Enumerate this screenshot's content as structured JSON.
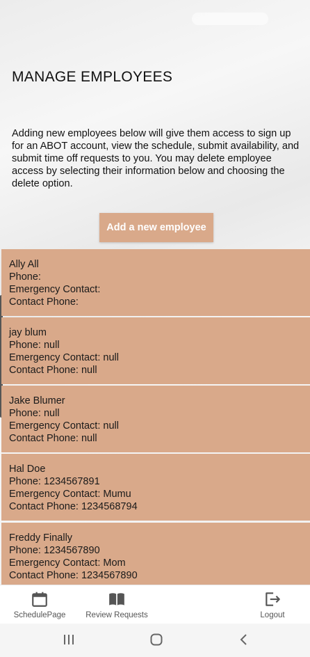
{
  "page": {
    "title": "MANAGE EMPLOYEES",
    "description": "Adding new employees below will give them access to sign up for an ABOT account, view the schedule, submit availability, and submit time off requests to you. You may delete employee access by selecting their information below and choosing the delete option.",
    "add_button_label": "Add a new employee"
  },
  "employees": [
    {
      "name": "Ally All",
      "phone": "Phone:",
      "emergency": "Emergency Contact:",
      "contact_phone": "Contact Phone:"
    },
    {
      "name": "jay blum",
      "phone": "Phone: null",
      "emergency": "Emergency Contact: null",
      "contact_phone": "Contact Phone: null"
    },
    {
      "name": "Jake Blumer",
      "phone": "Phone: null",
      "emergency": "Emergency Contact: null",
      "contact_phone": "Contact Phone: null"
    },
    {
      "name": "Hal Doe",
      "phone": "Phone: 1234567891",
      "emergency": "Emergency Contact: Mumu",
      "contact_phone": "Contact Phone: 1234568794"
    },
    {
      "name": "Freddy Finally",
      "phone": "Phone: 1234567890",
      "emergency": "Emergency Contact: Mom",
      "contact_phone": "Contact Phone: 1234567890"
    }
  ],
  "bottom_nav": {
    "schedule": {
      "label": "SchedulePage",
      "icon": "calendar-icon"
    },
    "requests": {
      "label": "Review Requests",
      "icon": "book-icon"
    },
    "logout": {
      "label": "Logout",
      "icon": "logout-icon"
    }
  },
  "system_nav": {
    "recents": "recents-icon",
    "home": "home-icon",
    "back": "back-icon"
  },
  "colors": {
    "card_background": "#d9a98a",
    "button_background": "#d9a98a",
    "button_text": "#ffffff",
    "nav_icon": "#555555"
  }
}
